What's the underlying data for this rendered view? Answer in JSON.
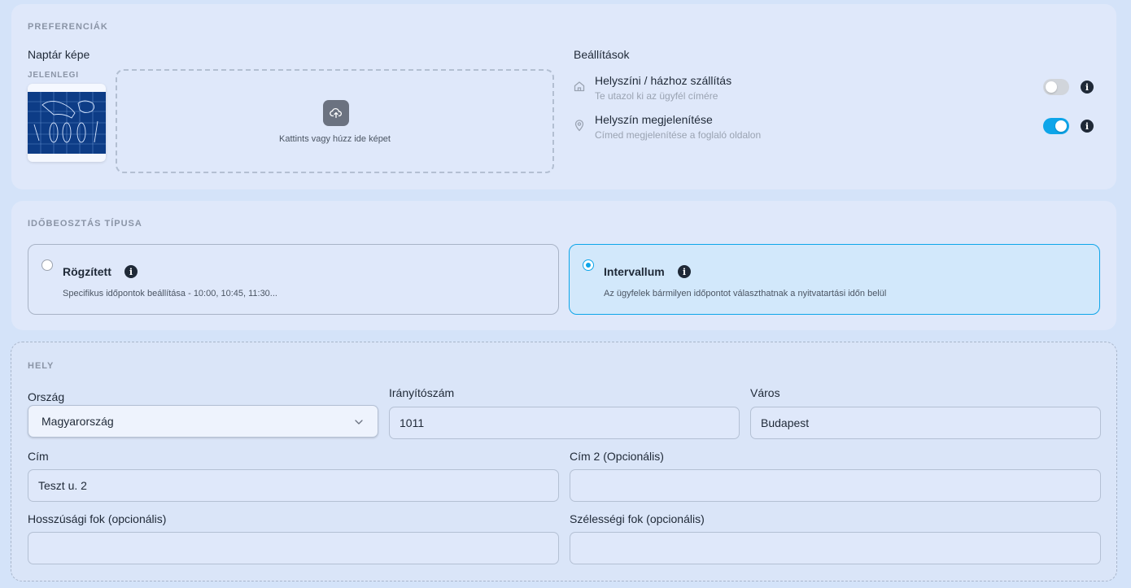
{
  "preferences": {
    "section_label": "PREFERENCIÁK",
    "calendar_image_title": "Naptár képe",
    "current_label": "JELENLEGI",
    "upload_text": "Kattints vagy húzz ide képet",
    "settings_title": "Beállítások",
    "settings": [
      {
        "icon": "home-icon",
        "title": "Helyszíni / házhoz szállítás",
        "subtitle": "Te utazol ki az ügyfél címére",
        "enabled": false
      },
      {
        "icon": "map-pin-icon",
        "title": "Helyszín megjelenítése",
        "subtitle": "Címed megjelenítése a foglaló oldalon",
        "enabled": true
      }
    ]
  },
  "schedule_type": {
    "section_label": "IDŐBEOSZTÁS TÍPUSA",
    "options": [
      {
        "title": "Rögzített",
        "description": "Specifikus időpontok beállítása - 10:00, 10:45, 11:30...",
        "selected": false
      },
      {
        "title": "Intervallum",
        "description": "Az ügyfelek bármilyen időpontot választhatnak a nyitvatartási időn belül",
        "selected": true
      }
    ]
  },
  "location": {
    "section_label": "HELY",
    "country": {
      "label": "Ország",
      "value": "Magyarország"
    },
    "zip": {
      "label": "Irányítószám",
      "value": "1011"
    },
    "city": {
      "label": "Város",
      "value": "Budapest"
    },
    "address": {
      "label": "Cím",
      "value": "Teszt u. 2"
    },
    "address2": {
      "label": "Cím 2 (Opcionális)",
      "value": ""
    },
    "longitude": {
      "label": "Hosszúsági fok (opcionális)",
      "value": ""
    },
    "latitude": {
      "label": "Szélességi fok (opcionális)",
      "value": ""
    }
  },
  "colors": {
    "accent": "#0ea5e9",
    "background": "#d4e3f9",
    "card": "#dfe8fa"
  }
}
